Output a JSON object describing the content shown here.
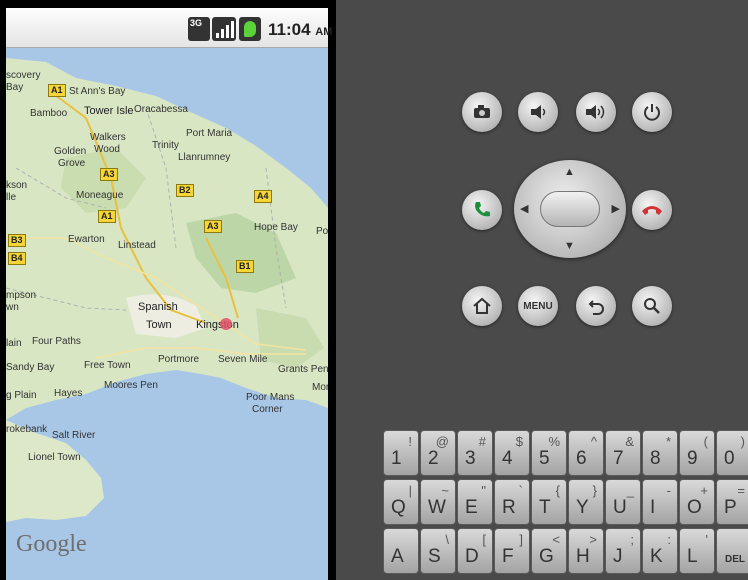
{
  "status_bar": {
    "network": "3G",
    "time": "11:04",
    "ampm": "AM"
  },
  "map": {
    "logo": "Google",
    "places": [
      "scovery",
      "Bay",
      "St Ann's Bay",
      "Bamboo",
      "Tower Isle",
      "Oracabessa",
      "Port Maria",
      "Walkers",
      "Wood",
      "Golden",
      "Grove",
      "Trinity",
      "Llanrumney",
      "kson",
      "lle",
      "Moneague",
      "Ewarton",
      "Linstead",
      "Hope Bay",
      "Po",
      "mpson",
      "wn",
      "Spanish",
      "Town",
      "Kingston",
      "lain",
      "Four Paths",
      "Sandy Bay",
      "Free Town",
      "Portmore",
      "Seven Mile",
      "Grants Pen",
      "Moores Pen",
      "Mor",
      "g Plain",
      "Hayes",
      "Poor Mans",
      "Corner",
      "rokebank",
      "Salt River",
      "Lionel Town"
    ],
    "shields": [
      "A1",
      "A3",
      "B2",
      "A4",
      "A1",
      "A3",
      "B3",
      "B4",
      "B1"
    ]
  },
  "controls": {
    "camera_icon": "camera-icon",
    "volume_down_icon": "volume-down-icon",
    "volume_up_icon": "volume-up-icon",
    "power_icon": "power-icon",
    "call_icon": "call-icon",
    "end_call_icon": "end-call-icon",
    "home_icon": "home-icon",
    "menu_label": "MENU",
    "back_icon": "back-icon",
    "search_icon": "search-icon",
    "colors": {
      "call": "#1e8f3c",
      "end_call": "#d23232"
    }
  },
  "keyboard": {
    "rows": [
      [
        {
          "main": "1",
          "alt": "!"
        },
        {
          "main": "2",
          "alt": "@"
        },
        {
          "main": "3",
          "alt": "#"
        },
        {
          "main": "4",
          "alt": "$"
        },
        {
          "main": "5",
          "alt": "%"
        },
        {
          "main": "6",
          "alt": "^"
        },
        {
          "main": "7",
          "alt": "&"
        },
        {
          "main": "8",
          "alt": "*"
        },
        {
          "main": "9",
          "alt": "("
        },
        {
          "main": "0",
          "alt": ")"
        }
      ],
      [
        {
          "main": "Q",
          "alt": "|"
        },
        {
          "main": "W",
          "alt": "~"
        },
        {
          "main": "E",
          "alt": "\""
        },
        {
          "main": "R",
          "alt": "`"
        },
        {
          "main": "T",
          "alt": "{"
        },
        {
          "main": "Y",
          "alt": "}"
        },
        {
          "main": "U",
          "alt": "_"
        },
        {
          "main": "I",
          "alt": "-"
        },
        {
          "main": "O",
          "alt": "+"
        },
        {
          "main": "P",
          "alt": "="
        }
      ],
      [
        {
          "main": "A",
          "alt": ""
        },
        {
          "main": "S",
          "alt": "\\"
        },
        {
          "main": "D",
          "alt": "["
        },
        {
          "main": "F",
          "alt": "]"
        },
        {
          "main": "G",
          "alt": "<"
        },
        {
          "main": "H",
          "alt": ">"
        },
        {
          "main": "J",
          "alt": ";"
        },
        {
          "main": "K",
          "alt": ":"
        },
        {
          "main": "L",
          "alt": "'"
        },
        {
          "main": "DEL",
          "alt": ""
        }
      ]
    ]
  }
}
